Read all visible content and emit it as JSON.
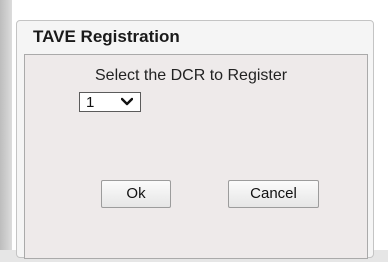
{
  "dialog": {
    "title": "TAVE Registration",
    "prompt": "Select the DCR to Register",
    "dcr_select": {
      "value": "1",
      "icon": "chevron-down-icon"
    },
    "ok_label": "Ok",
    "cancel_label": "Cancel"
  }
}
